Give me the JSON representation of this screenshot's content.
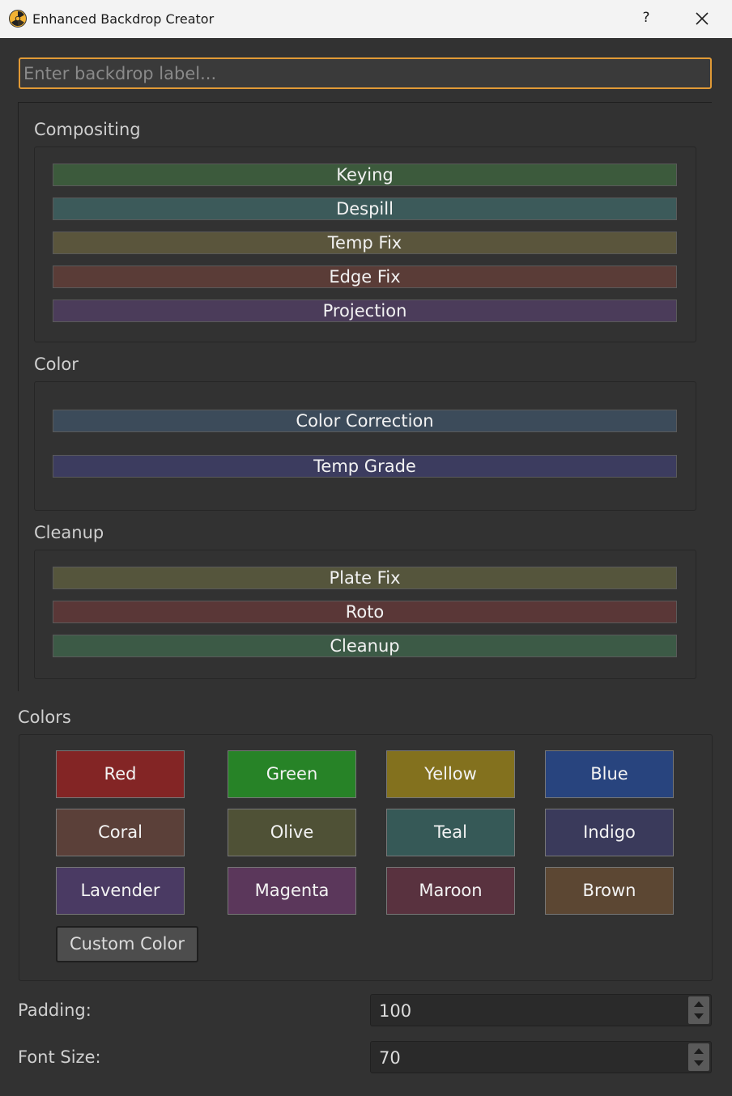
{
  "window": {
    "title": "Enhanced Backdrop Creator",
    "help": "?",
    "close_icon": "close-icon"
  },
  "label_input": {
    "placeholder": "Enter backdrop label...",
    "value": ""
  },
  "sections": [
    {
      "title": "Compositing",
      "buttons": [
        "Keying",
        "Despill",
        "Temp Fix",
        "Edge Fix",
        "Projection"
      ]
    },
    {
      "title": "Color",
      "buttons": [
        "Color Correction",
        "Temp Grade"
      ]
    },
    {
      "title": "Cleanup",
      "buttons": [
        "Plate Fix",
        "Roto",
        "Cleanup"
      ]
    }
  ],
  "preset_colors": {
    "Keying": "#3c5a3c",
    "Despill": "#3c5a5a",
    "Temp Fix": "#5a553c",
    "Edge Fix": "#5a3c37",
    "Projection": "#4b3c5a",
    "Color Correction": "#3c4b5a",
    "Temp Grade": "#3c3c5f",
    "Plate Fix": "#55553c",
    "Roto": "#5a3737",
    "Cleanup": "#3c5a46"
  },
  "colors": {
    "title": "Colors",
    "swatches": [
      {
        "label": "Red",
        "color": "#832525"
      },
      {
        "label": "Green",
        "color": "#278327"
      },
      {
        "label": "Yellow",
        "color": "#83711e"
      },
      {
        "label": "Blue",
        "color": "#28447e"
      },
      {
        "label": "Coral",
        "color": "#5b4039"
      },
      {
        "label": "Olive",
        "color": "#4f5136"
      },
      {
        "label": "Teal",
        "color": "#365957"
      },
      {
        "label": "Indigo",
        "color": "#3a3a5b"
      },
      {
        "label": "Lavender",
        "color": "#4a3a63"
      },
      {
        "label": "Magenta",
        "color": "#5b375b"
      },
      {
        "label": "Maroon",
        "color": "#59323f"
      },
      {
        "label": "Brown",
        "color": "#5c4733"
      }
    ],
    "custom_label": "Custom Color"
  },
  "padding": {
    "label": "Padding:",
    "value": "100"
  },
  "font_size": {
    "label": "Font Size:",
    "value": "70"
  }
}
